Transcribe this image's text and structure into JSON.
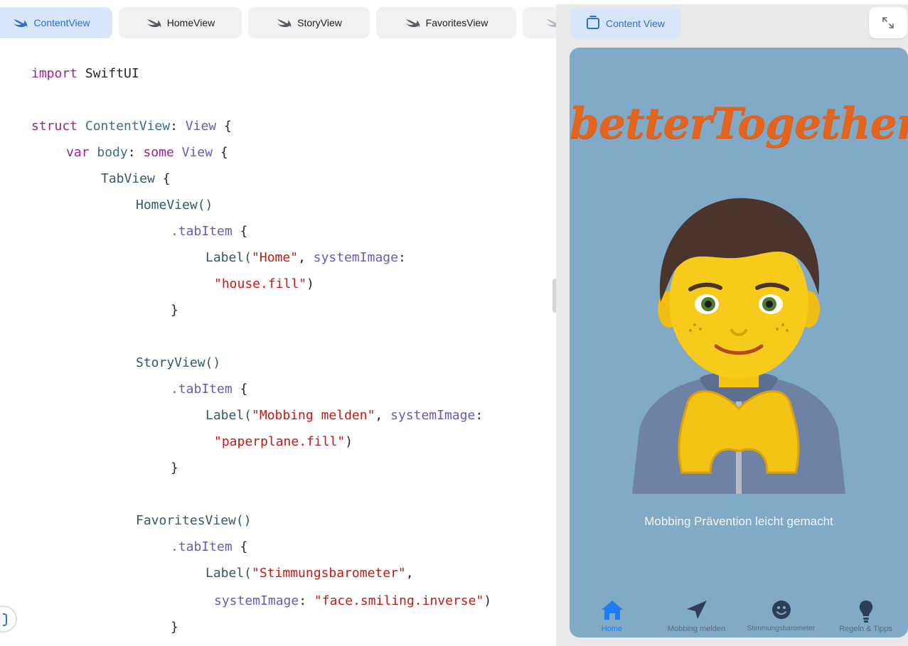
{
  "editor": {
    "file_tabs": [
      {
        "label": "ContentView",
        "active": true
      },
      {
        "label": "HomeView",
        "active": false
      },
      {
        "label": "StoryView",
        "active": false
      },
      {
        "label": "FavoritesView",
        "active": false
      }
    ],
    "code": {
      "import_kw": "import",
      "import_mod": "SwiftUI",
      "struct_kw": "struct",
      "struct_name": "ContentView",
      "colon": ":",
      "view_type": "View",
      "brace_open": "{",
      "var_kw": "var",
      "body_name": "body",
      "some_kw": "some",
      "tabview": "TabView",
      "homeview_call": "HomeView()",
      "storyview_call": "StoryView()",
      "favoritesview_call": "FavoritesView()",
      "tabitem": ".tabItem",
      "label_fn": "Label(",
      "home_str": "\"Home\"",
      "mobbing_str": "\"Mobbing melden\"",
      "stimmung_str": "\"Stimmungsbarometer\"",
      "system_image_param": "systemImage",
      "house_str": "\"house.fill\"",
      "paperplane_str": "\"paperplane.fill\"",
      "face_str": "\"face.smiling.inverse\"",
      "close_paren": ")",
      "brace_close": "}",
      "comma": ","
    }
  },
  "canvas": {
    "preview_tab_label": "Content View",
    "expand_icon": "arrow-expand-icon"
  },
  "app": {
    "logo_text": "betterTogether",
    "tagline": "Mobbing Prävention leicht gemacht",
    "tabs": [
      {
        "label": "Home",
        "icon": "house-fill-icon",
        "active": true
      },
      {
        "label": "Mobbing melden",
        "icon": "paperplane-fill-icon",
        "active": false
      },
      {
        "label": "Stimmungsbarometer",
        "icon": "face-smiling-inverse-icon",
        "active": false
      },
      {
        "label": "Regeln & Tipps",
        "icon": "lightbulb-fill-icon",
        "active": false
      }
    ],
    "colors": {
      "accent": "#1f7cf2",
      "background": "#80aac6",
      "logo": "#e2641d"
    }
  }
}
